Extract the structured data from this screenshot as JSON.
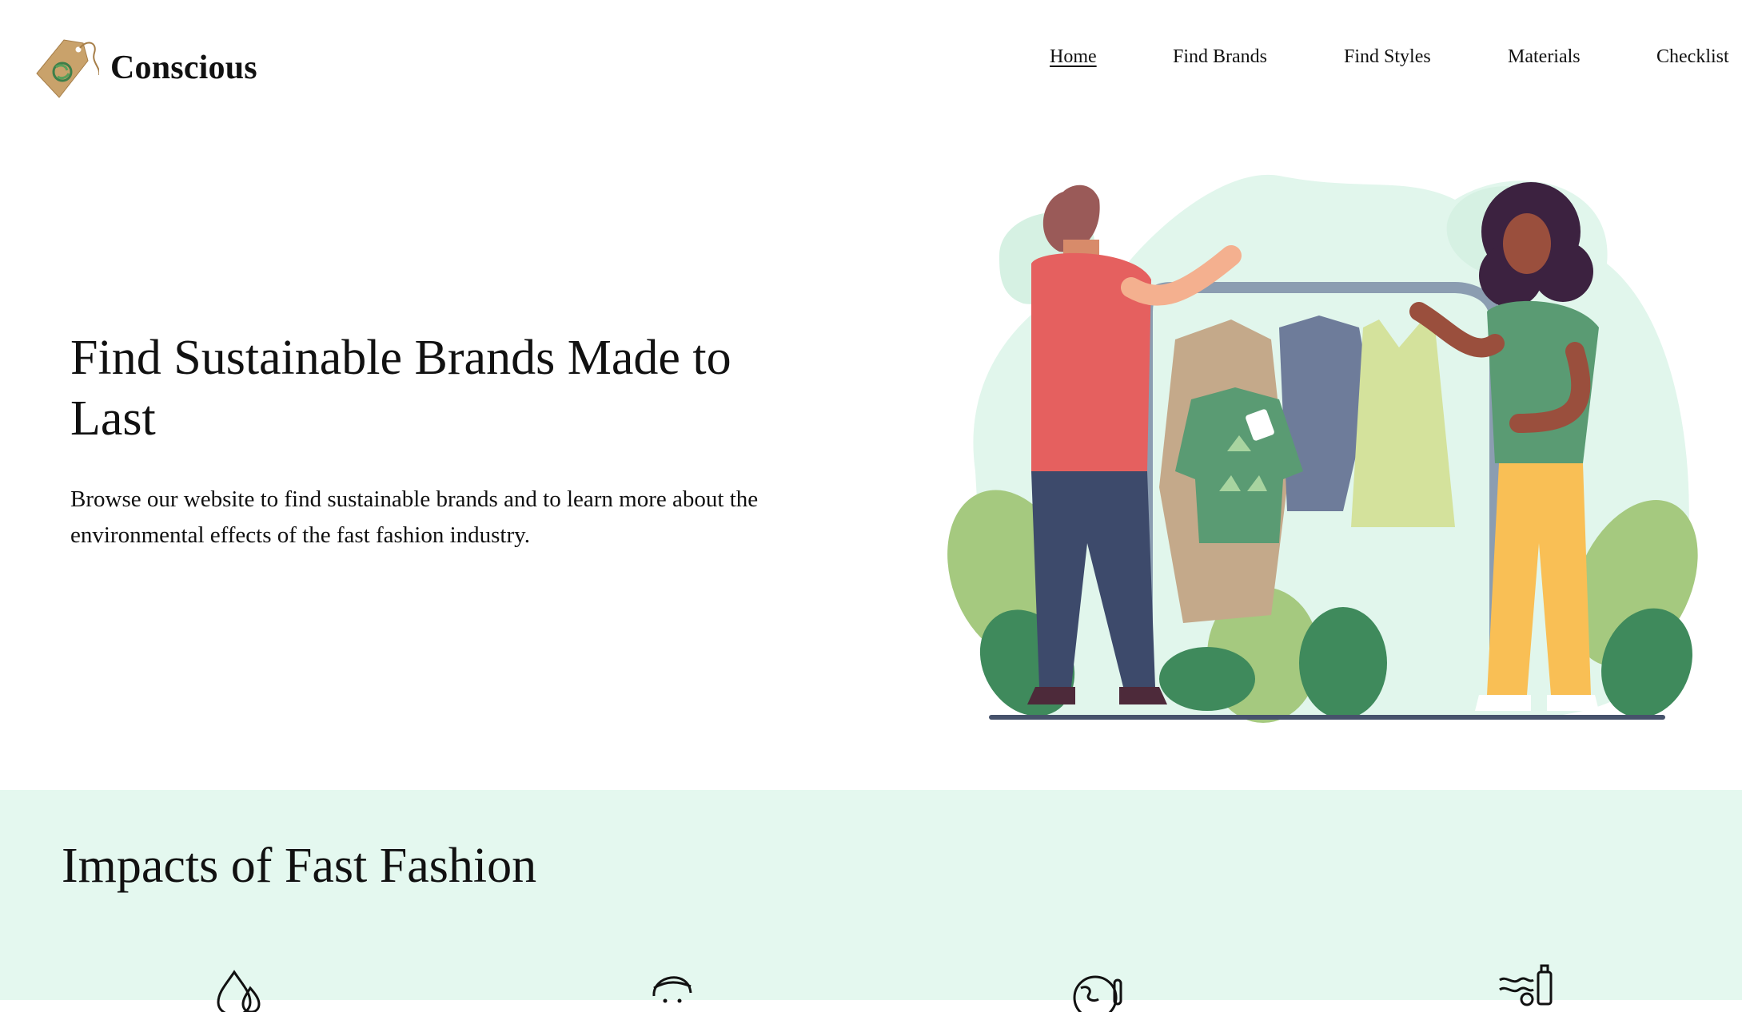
{
  "brand": {
    "name": "Conscious"
  },
  "nav": {
    "items": [
      {
        "label": "Home",
        "active": true
      },
      {
        "label": "Find Brands"
      },
      {
        "label": "Find Styles"
      },
      {
        "label": "Materials"
      },
      {
        "label": "Checklist"
      }
    ]
  },
  "hero": {
    "title": "Find Sustainable Brands Made to Last",
    "description": "Browse our website to find sustainable brands and to learn more about the environmental effects of the fast fashion industry."
  },
  "impacts": {
    "title": "Impacts of Fast Fashion",
    "icons": [
      "water-drop-icon",
      "person-face-icon",
      "globe-thermometer-icon",
      "polluted-water-icon"
    ]
  },
  "colors": {
    "section_background": "#e4f8ef",
    "illustration_blob": "#e1f6ec",
    "tag_tan": "#c9a26b",
    "shirt_green": "#5a9b73",
    "shirt_red": "#e5605f"
  }
}
